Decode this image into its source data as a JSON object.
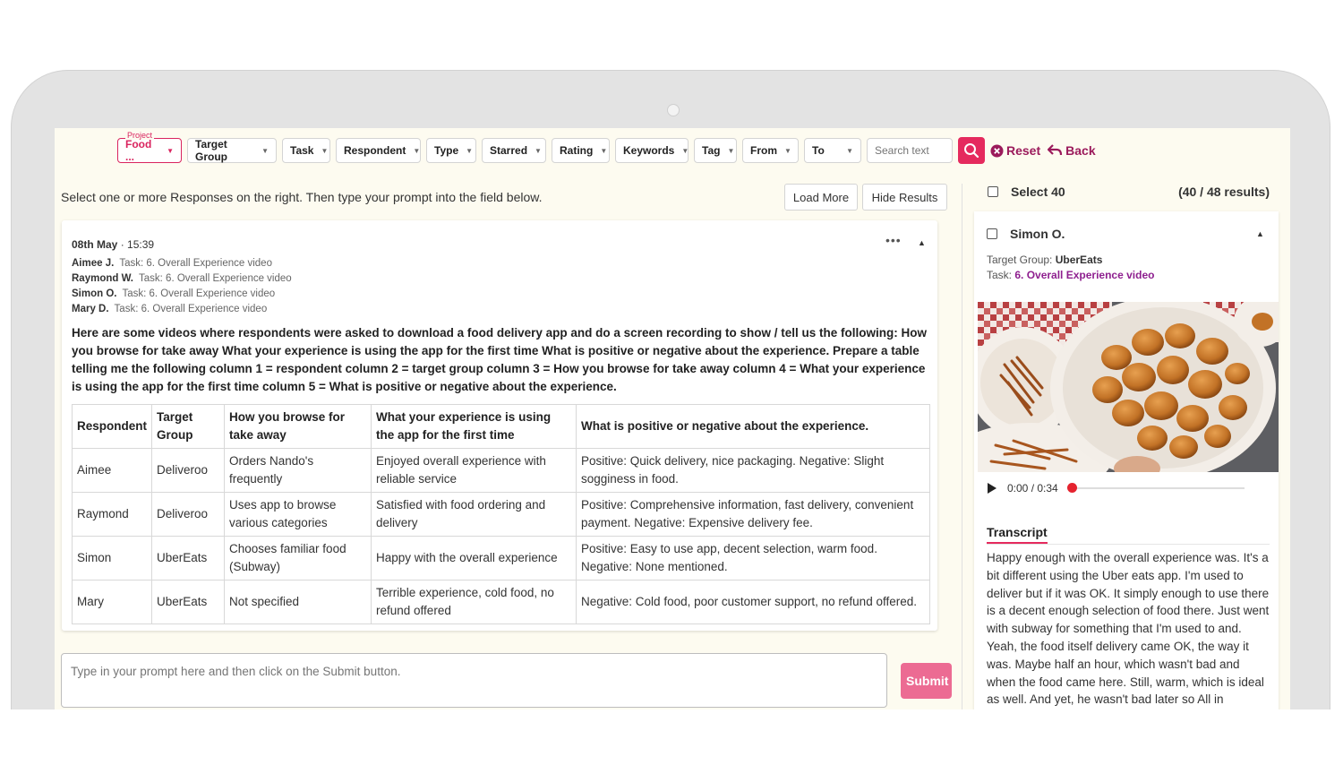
{
  "filters": {
    "project_label": "Project",
    "project_value": "Food ...",
    "dropdowns": [
      "Target Group",
      "Task",
      "Respondent",
      "Type",
      "Starred",
      "Rating",
      "Keywords",
      "Tag",
      "From",
      "To"
    ],
    "search_placeholder": "Search text",
    "reset_label": "Reset",
    "back_label": "Back"
  },
  "main": {
    "instructions": "Select one or more Responses on the right. Then type your prompt into the field below.",
    "load_more_label": "Load More",
    "hide_results_label": "Hide Results",
    "card": {
      "date": "08th May",
      "time": "· 15:39",
      "menu": "•••",
      "responses": [
        {
          "name": "Aimee J.",
          "task": "Task: 6. Overall Experience video"
        },
        {
          "name": "Raymond W.",
          "task": "Task: 6. Overall Experience video"
        },
        {
          "name": "Simon O.",
          "task": "Task: 6. Overall Experience video"
        },
        {
          "name": "Mary D.",
          "task": "Task: 6. Overall Experience video"
        }
      ],
      "prompt": "Here are some videos where respondents were asked to download a food delivery app and do a screen recording to show / tell us the following: How you browse for take away What your experience is using the app for the first time What is positive or negative about the experience. Prepare a table telling me the following column 1 = respondent column 2 = target group column 3 = How you browse for take away column 4 = What your experience is using the app for the first time column 5 = What is positive or negative about the experience.",
      "table": {
        "headers": [
          "Respondent",
          "Target Group",
          "How you browse for take away",
          "What your experience is using the app for the first time",
          "What is positive or negative about the experience."
        ],
        "rows": [
          [
            "Aimee",
            "Deliveroo",
            "Orders Nando's frequently",
            "Enjoyed overall experience with reliable service",
            "Positive: Quick delivery, nice packaging. Negative: Slight sogginess in food."
          ],
          [
            "Raymond",
            "Deliveroo",
            "Uses app to browse various categories",
            "Satisfied with food ordering and delivery",
            "Positive: Comprehensive information, fast delivery, convenient payment. Negative: Expensive delivery fee."
          ],
          [
            "Simon",
            "UberEats",
            "Chooses familiar food (Subway)",
            "Happy with the overall experience",
            "Positive: Easy to use app, decent selection, warm food. Negative: None mentioned."
          ],
          [
            "Mary",
            "UberEats",
            "Not specified",
            "Terrible experience, cold food, no refund offered",
            "Negative: Cold food, poor customer support, no refund offered."
          ]
        ]
      }
    },
    "prompt_placeholder": "Type in your prompt here and then click on the Submit button.",
    "submit_label": "Submit"
  },
  "right": {
    "select_label": "Select 40",
    "results_count": "(40 / 48 results)",
    "respondent": {
      "name": "Simon O.",
      "target_group_label": "Target Group:",
      "target_group_value": "UberEats",
      "task_label": "Task:",
      "task_value": "6. Overall Experience video"
    },
    "player": {
      "time": "0:00 / 0:34",
      "progress": 0
    },
    "transcript_tab": "Transcript",
    "transcript": "Happy enough with the overall experience was. It's a bit different using the Uber eats app. I'm used to deliver but if it was OK. It simply enough to use there is a decent enough selection of food there. Just went with subway for something that I'm used to and. Yeah, the food itself delivery came OK, the way it was. Maybe half an hour, which wasn't bad and when the food came here. Still, warm, which is ideal as well. And yet, he wasn't bad later so All in"
  },
  "colors": {
    "accent": "#e52a5e",
    "link": "#9b1a5b",
    "task_link": "#8e1f8f",
    "screen_bg": "#fdfbf0"
  }
}
